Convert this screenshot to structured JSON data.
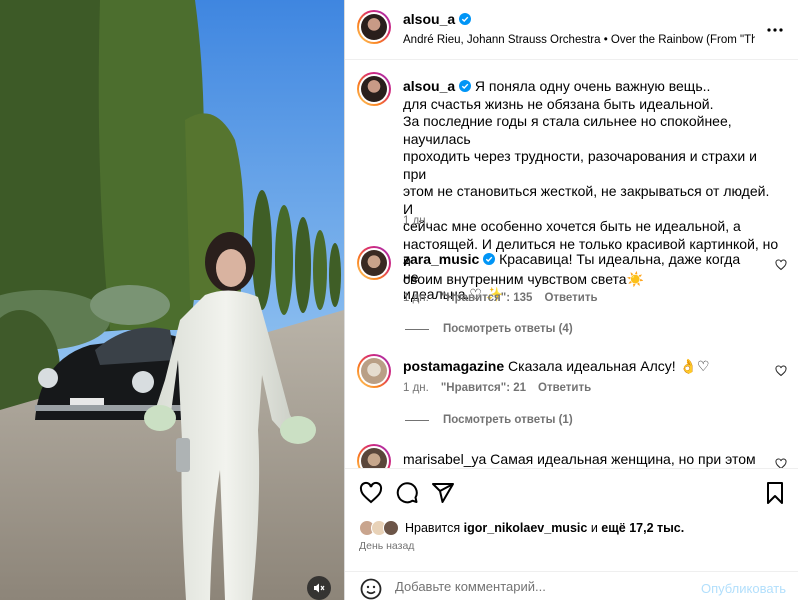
{
  "post_header": {
    "username": "alsou_a",
    "music": "André Rieu, Johann Strauss Orchestra • Over the Rainbow (From \"The Wi"
  },
  "caption": {
    "username": "alsou_a",
    "lines": [
      "Я поняла одну очень важную вещь..",
      "для счастья жизнь не обязана быть идеальной.",
      "За последние годы я стала сильнее но спокойнее, научилась",
      "проходить через трудности, разочарования и страхи и при",
      "этом не становиться жесткой, не закрываться от людей. И",
      "сейчас мне особенно хочется быть не идеальной, а",
      "настоящей. И делиться не только красивой картинкой, но и",
      "своим внутренним чувством света☀️"
    ],
    "time": "1 дн."
  },
  "comments": [
    {
      "username": "zara_music",
      "text_line1": "Красавица! Ты идеальна, даже когда не",
      "text_line2": "идеальна.♡ ✨",
      "time": "1 дн.",
      "likes": "\"Нравится\": 135",
      "reply": "Ответить",
      "view_replies": "Посмотреть ответы (4)"
    },
    {
      "username": "postamagazine",
      "text_line1": "Сказала идеальная Алсу! 👌♡",
      "time": "1 дн.",
      "likes": "\"Нравится\": 21",
      "reply": "Ответить",
      "view_replies": "Посмотреть ответы (1)"
    },
    {
      "username": "marisabel_ya",
      "text_line1": "Самая идеальная женщина, но при этом живая"
    }
  ],
  "likes_info": {
    "prefix": "Нравится",
    "user": "igor_nikolaev_music",
    "middle": "и",
    "others": "ещё 17,2 тыс."
  },
  "date": "День назад",
  "add_comment": {
    "placeholder": "Добавьте комментарий...",
    "post_label": "Опубликовать"
  },
  "colors": {
    "verified": "#0095f6",
    "muted_text": "#737373",
    "post_button_disabled": "#b2dffc",
    "story_ring": "#d62976"
  },
  "icons": {
    "header": [
      "verified-icon",
      "more-icon"
    ],
    "actions": [
      "heart-icon",
      "comment-icon",
      "share-icon",
      "bookmark-icon"
    ],
    "media": [
      "mute-icon"
    ],
    "input": [
      "emoji-icon"
    ]
  }
}
